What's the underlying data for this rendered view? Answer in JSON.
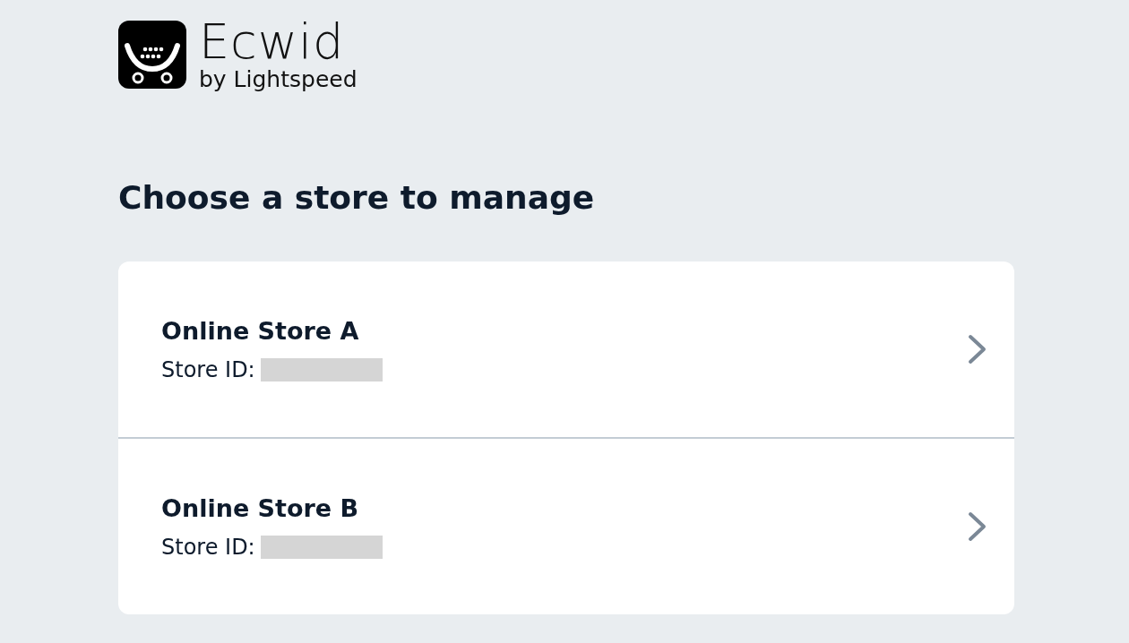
{
  "logo": {
    "name": "Ecwid",
    "tagline": "by Lightspeed"
  },
  "heading": "Choose a store to manage",
  "stores": [
    {
      "name": "Online Store A",
      "id_label": "Store ID:",
      "id_redacted": true
    },
    {
      "name": "Online Store B",
      "id_label": "Store ID:",
      "id_redacted": true
    }
  ]
}
